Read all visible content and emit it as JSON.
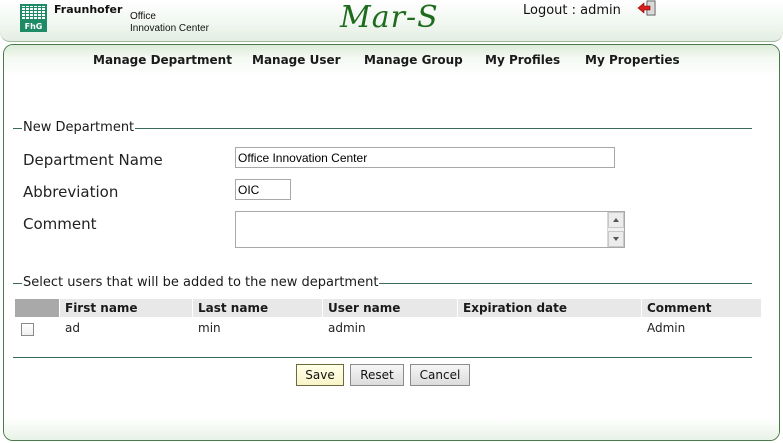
{
  "header": {
    "brand_name": "Fraunhofer",
    "brand_sub_line1": "Office",
    "brand_sub_line2": "Innovation Center",
    "logo_text": "FhG",
    "app_title": "Mar-S",
    "logout_text": "Logout : admin",
    "logout_icon": "logout-arrow-icon"
  },
  "nav": {
    "items": [
      {
        "label": "Manage Department"
      },
      {
        "label": "Manage User"
      },
      {
        "label": "Manage Group"
      },
      {
        "label": "My Profiles"
      },
      {
        "label": "My Properties"
      }
    ]
  },
  "form": {
    "legend": "New Department",
    "fields": {
      "department_name": {
        "label": "Department Name",
        "value": "Office Innovation Center"
      },
      "abbreviation": {
        "label": "Abbreviation",
        "value": "OIC"
      },
      "comment": {
        "label": "Comment",
        "value": ""
      }
    }
  },
  "users": {
    "legend": "Select users that will be added to the new department",
    "columns": [
      "First name",
      "Last name",
      "User name",
      "Expiration date",
      "Comment"
    ],
    "rows": [
      {
        "selected": false,
        "first_name": "ad",
        "last_name": "min",
        "user_name": "admin",
        "expiration_date": "",
        "comment": "Admin"
      }
    ]
  },
  "actions": {
    "save_label": "Save",
    "reset_label": "Reset",
    "cancel_label": "Cancel"
  },
  "colors": {
    "brand_green": "#1e8a66",
    "title_green": "#1e6b1e",
    "panel_border": "#4a7a4a",
    "header_cell": "#e8e8e8",
    "select_header_cell": "#a9a9a9"
  }
}
